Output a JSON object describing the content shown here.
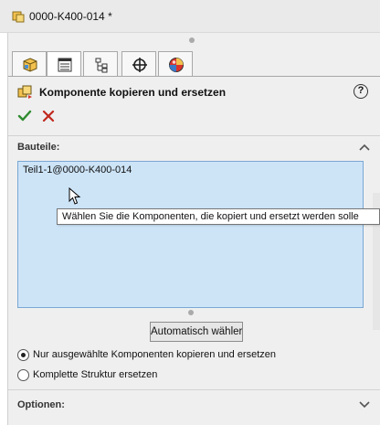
{
  "window": {
    "title": "0000-K400-014 *"
  },
  "tabs": [
    {
      "name": "feature-manager-tab",
      "icon": "part-cube-icon"
    },
    {
      "name": "property-manager-tab",
      "icon": "property-list-icon",
      "active": true
    },
    {
      "name": "configuration-manager-tab",
      "icon": "configuration-icon"
    },
    {
      "name": "dimxpert-tab",
      "icon": "crosshair-icon"
    },
    {
      "name": "display-manager-tab",
      "icon": "display-sphere-icon"
    }
  ],
  "property_manager": {
    "title": "Komponente kopieren und ersetzen",
    "help_label": "?",
    "ok_icon": "checkmark-icon",
    "cancel_icon": "x-icon"
  },
  "parts_group": {
    "heading": "Bauteile:",
    "selected_items": [
      "Teil1-1@0000-K400-014"
    ]
  },
  "tooltip": "Wählen Sie die Komponenten, die kopiert und ersetzt werden solle",
  "auto_select_button": "Automatisch wähler",
  "options": [
    {
      "label": "Nur ausgewählte Komponenten kopieren und ersetzen",
      "checked": true
    },
    {
      "label": "Komplette Struktur ersetzen",
      "checked": false
    }
  ],
  "options_group": {
    "heading": "Optionen:"
  },
  "colors": {
    "selection_box": "#cde4f7",
    "ok_green": "#2e8b2e",
    "cancel_red": "#c0281e"
  }
}
